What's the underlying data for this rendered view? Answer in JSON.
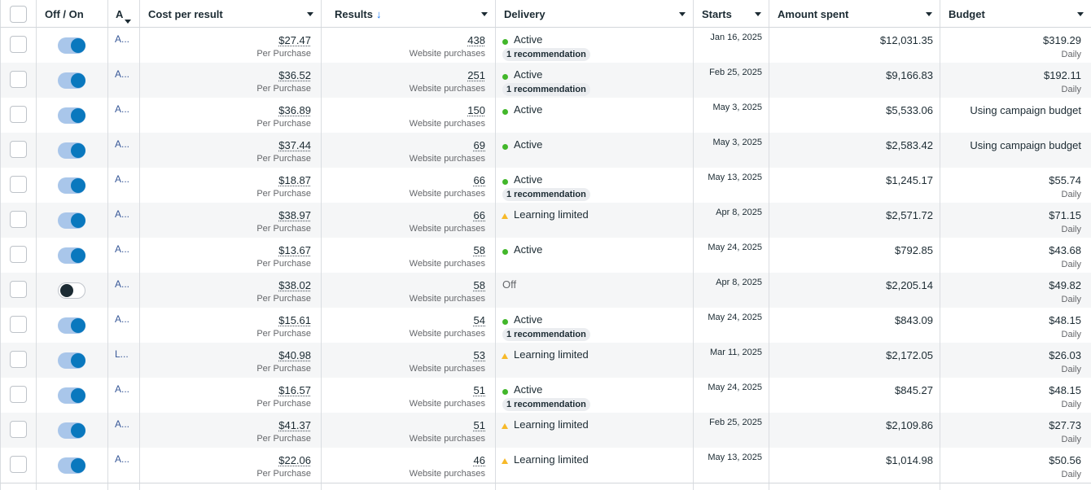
{
  "columns": {
    "off_on": "Off / On",
    "name": "A",
    "cost_per_result": "Cost per result",
    "results": "Results",
    "results_sort": "↓",
    "delivery": "Delivery",
    "starts": "Starts",
    "amount_spent": "Amount spent",
    "budget": "Budget"
  },
  "rows": [
    {
      "on": true,
      "name": "A...",
      "cost": "$27.47",
      "cost_sub": "Per Purchase",
      "results": "438",
      "results_sub": "Website purchases",
      "status": "active",
      "delivery": "Active",
      "rec": "1 recommendation",
      "starts": "Jan 16, 2025",
      "spent": "$12,031.35",
      "budget": "$319.29",
      "budget_sub": "Daily"
    },
    {
      "on": true,
      "name": "A...",
      "cost": "$36.52",
      "cost_sub": "Per Purchase",
      "results": "251",
      "results_sub": "Website purchases",
      "status": "active",
      "delivery": "Active",
      "rec": "1 recommendation",
      "starts": "Feb 25, 2025",
      "spent": "$9,166.83",
      "budget": "$192.11",
      "budget_sub": "Daily"
    },
    {
      "on": true,
      "name": "A...",
      "cost": "$36.89",
      "cost_sub": "Per Purchase",
      "results": "150",
      "results_sub": "Website purchases",
      "status": "active",
      "delivery": "Active",
      "rec": "",
      "starts": "May 3, 2025",
      "spent": "$5,533.06",
      "budget": "Using campaign budget",
      "budget_sub": ""
    },
    {
      "on": true,
      "name": "A...",
      "cost": "$37.44",
      "cost_sub": "Per Purchase",
      "results": "69",
      "results_sub": "Website purchases",
      "status": "active",
      "delivery": "Active",
      "rec": "",
      "starts": "May 3, 2025",
      "spent": "$2,583.42",
      "budget": "Using campaign budget",
      "budget_sub": ""
    },
    {
      "on": true,
      "name": "A...",
      "cost": "$18.87",
      "cost_sub": "Per Purchase",
      "results": "66",
      "results_sub": "Website purchases",
      "status": "active",
      "delivery": "Active",
      "rec": "1 recommendation",
      "starts": "May 13, 2025",
      "spent": "$1,245.17",
      "budget": "$55.74",
      "budget_sub": "Daily"
    },
    {
      "on": true,
      "name": "A...",
      "cost": "$38.97",
      "cost_sub": "Per Purchase",
      "results": "66",
      "results_sub": "Website purchases",
      "status": "learning",
      "delivery": "Learning limited",
      "rec": "",
      "starts": "Apr 8, 2025",
      "spent": "$2,571.72",
      "budget": "$71.15",
      "budget_sub": "Daily"
    },
    {
      "on": true,
      "name": "A...",
      "cost": "$13.67",
      "cost_sub": "Per Purchase",
      "results": "58",
      "results_sub": "Website purchases",
      "status": "active",
      "delivery": "Active",
      "rec": "",
      "starts": "May 24, 2025",
      "spent": "$792.85",
      "budget": "$43.68",
      "budget_sub": "Daily"
    },
    {
      "on": false,
      "name": "A...",
      "cost": "$38.02",
      "cost_sub": "Per Purchase",
      "results": "58",
      "results_sub": "Website purchases",
      "status": "off",
      "delivery": "Off",
      "rec": "",
      "starts": "Apr 8, 2025",
      "spent": "$2,205.14",
      "budget": "$49.82",
      "budget_sub": "Daily"
    },
    {
      "on": true,
      "name": "A...",
      "cost": "$15.61",
      "cost_sub": "Per Purchase",
      "results": "54",
      "results_sub": "Website purchases",
      "status": "active",
      "delivery": "Active",
      "rec": "1 recommendation",
      "starts": "May 24, 2025",
      "spent": "$843.09",
      "budget": "$48.15",
      "budget_sub": "Daily"
    },
    {
      "on": true,
      "name": "L...",
      "cost": "$40.98",
      "cost_sub": "Per Purchase",
      "results": "53",
      "results_sub": "Website purchases",
      "status": "learning",
      "delivery": "Learning limited",
      "rec": "",
      "starts": "Mar 11, 2025",
      "spent": "$2,172.05",
      "budget": "$26.03",
      "budget_sub": "Daily"
    },
    {
      "on": true,
      "name": "A...",
      "cost": "$16.57",
      "cost_sub": "Per Purchase",
      "results": "51",
      "results_sub": "Website purchases",
      "status": "active",
      "delivery": "Active",
      "rec": "1 recommendation",
      "starts": "May 24, 2025",
      "spent": "$845.27",
      "budget": "$48.15",
      "budget_sub": "Daily"
    },
    {
      "on": true,
      "name": "A...",
      "cost": "$41.37",
      "cost_sub": "Per Purchase",
      "results": "51",
      "results_sub": "Website purchases",
      "status": "learning",
      "delivery": "Learning limited",
      "rec": "",
      "starts": "Feb 25, 2025",
      "spent": "$2,109.86",
      "budget": "$27.73",
      "budget_sub": "Daily"
    },
    {
      "on": true,
      "name": "A...",
      "cost": "$22.06",
      "cost_sub": "Per Purchase",
      "results": "46",
      "results_sub": "Website purchases",
      "status": "learning",
      "delivery": "Learning limited",
      "rec": "",
      "starts": "May 13, 2025",
      "spent": "$1,014.98",
      "budget": "$50.56",
      "budget_sub": "Daily"
    }
  ],
  "colors": {
    "active": "#42b72a",
    "learning": "#f7b928",
    "toggle_on": "#0a78be",
    "link": "#385898"
  },
  "icons": {
    "sort": "arrow-down-icon",
    "dropdown": "caret-down-icon",
    "active": "status-dot-icon",
    "learning": "warning-triangle-icon"
  }
}
